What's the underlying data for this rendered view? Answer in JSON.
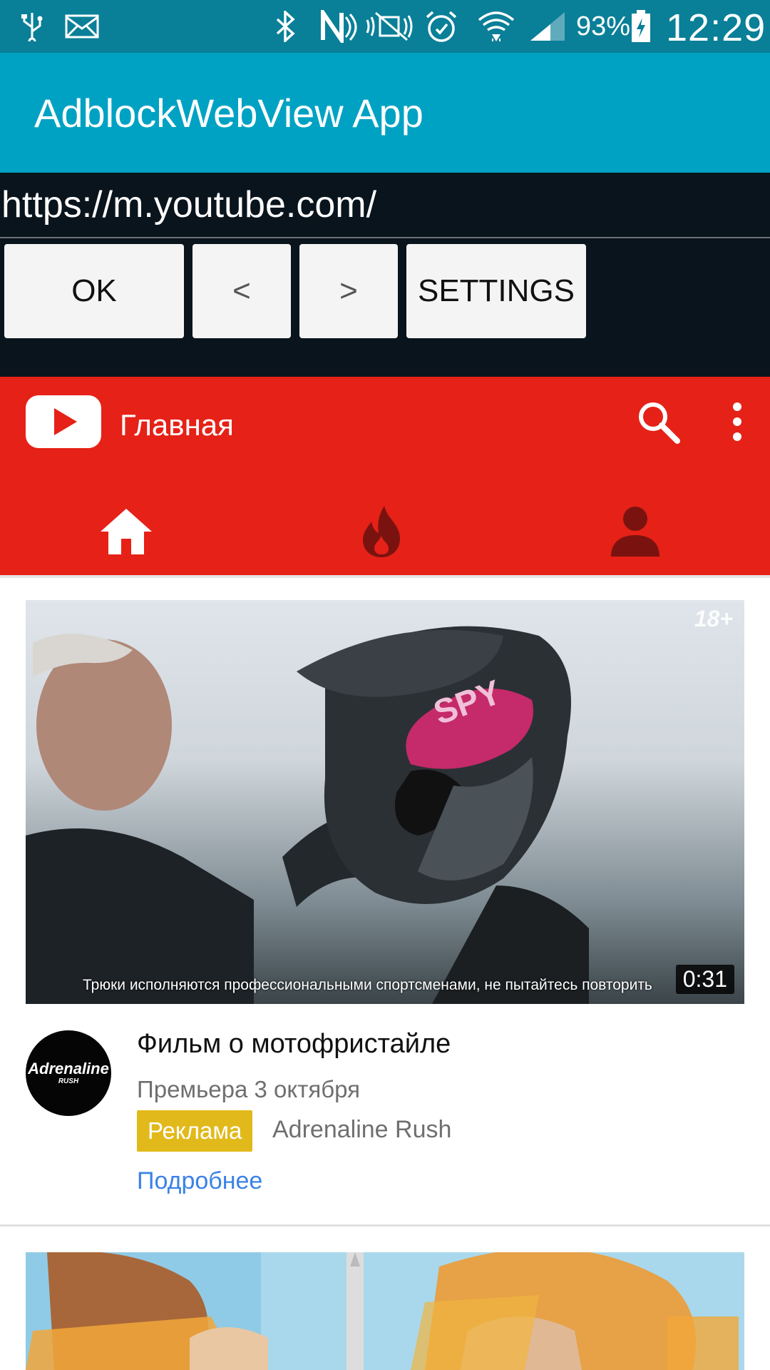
{
  "status_bar": {
    "battery_percent": "93%",
    "time": "12:29",
    "icons": [
      "usb-icon",
      "mail-icon",
      "bluetooth-icon",
      "nfc-icon",
      "mute-icon",
      "alarm-icon",
      "wifi-icon",
      "signal-icon",
      "battery-charging-icon"
    ]
  },
  "app_bar": {
    "title": "AdblockWebView App",
    "color": "#00a2c3"
  },
  "controls": {
    "url_value": "https://m.youtube.com/",
    "ok_label": "OK",
    "back_label": "<",
    "forward_label": ">",
    "settings_label": "SETTINGS"
  },
  "youtube": {
    "header_title": "Главная",
    "brand_color": "#e62117",
    "tabs": [
      "home-icon",
      "trending-icon",
      "account-icon"
    ]
  },
  "video": {
    "age_badge": "18+",
    "subtitle": "Трюки исполняются профессиональными спортсменами, не пытайтесь повторить",
    "duration": "0:31",
    "channel_logo_text": "Adrenaline",
    "channel_logo_sub": "RUSH",
    "title": "Фильм о мотофристайле",
    "meta": "Премьера 3 октября",
    "ad_label": "Реклама",
    "advertiser": "Adrenaline Rush",
    "learn_more": "Подробнее"
  }
}
